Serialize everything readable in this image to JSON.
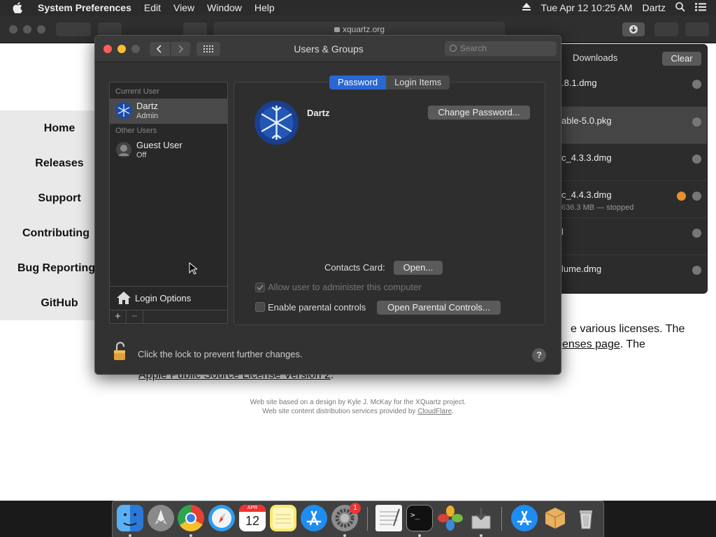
{
  "menubar": {
    "app_name": "System Preferences",
    "menus": [
      "Edit",
      "View",
      "Window",
      "Help"
    ],
    "clock": "Tue Apr 12  10:25 AM",
    "user": "Dartz"
  },
  "browser": {
    "url": "xquartz.org",
    "nav_links": [
      "Home",
      "Releases",
      "Support",
      "Contributing",
      "Bug Reporting",
      "GitHub"
    ],
    "body_text_1": "e various licenses. The",
    "body_text_2_link": "enses page",
    "body_text_2_rest": ". The",
    "body_text_3_link": "Apple Public Source License Version 2",
    "body_text_3_rest": ".",
    "footer_line_1": "Web site based on a design by Kyle J. McKay for the XQuartz project.",
    "footer_line_2_prefix": "Web site content distribution services provided by ",
    "footer_line_2_link": "CloudFlare",
    "footer_line_2_suffix": "."
  },
  "downloads": {
    "title": "Downloads",
    "clear_label": "Clear",
    "items": [
      {
        "name": ".8.1.dmg",
        "sub": ""
      },
      {
        "name": "able-5.0.pkg",
        "sub": ""
      },
      {
        "name": "c_4.3.3.dmg",
        "sub": ""
      },
      {
        "name": "c_4.4.3.dmg",
        "sub": "636.3 MB — stopped"
      },
      {
        "name": "l",
        "sub": ""
      },
      {
        "name": "lume.dmg",
        "sub": ""
      }
    ]
  },
  "users_groups": {
    "title": "Users & Groups",
    "search_placeholder": "Search",
    "current_user_header": "Current User",
    "other_users_header": "Other Users",
    "current_user": {
      "name": "Dartz",
      "role": "Admin"
    },
    "other_user": {
      "name": "Guest User",
      "role": "Off"
    },
    "login_options": "Login Options",
    "plus": "+",
    "minus": "−",
    "tabs": [
      "Password",
      "Login Items"
    ],
    "detail_name": "Dartz",
    "change_password": "Change Password...",
    "contacts_card_label": "Contacts Card:",
    "open_button": "Open...",
    "allow_admin_label": "Allow user to administer this computer",
    "parental_label": "Enable parental controls",
    "open_parental": "Open Parental Controls...",
    "lock_text": "Click the lock to prevent further changes.",
    "help": "?"
  },
  "dock": {
    "calendar_month": "APR",
    "calendar_day": "12",
    "sysprefs_badge": "1"
  },
  "colors": {
    "accent": "#2867d4",
    "close": "#fc5f57",
    "minimize": "#fdbc2e",
    "zoom": "#5a5a5a"
  }
}
